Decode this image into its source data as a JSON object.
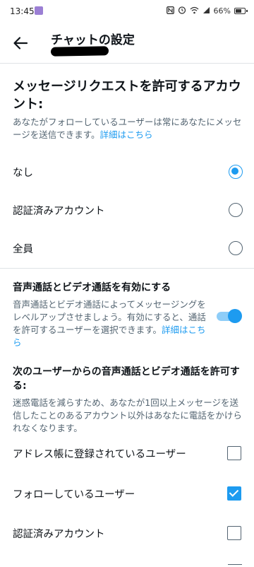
{
  "status_bar": {
    "time": "13:45",
    "battery_pct": "66%",
    "icons": [
      "nfc-icon",
      "alarm-icon",
      "wifi-icon",
      "signal-icon",
      "battery-icon"
    ]
  },
  "header": {
    "title": "チャットの設定",
    "back_icon": "arrow-left-icon"
  },
  "message_requests": {
    "heading": "メッセージリクエストを許可するアカウント:",
    "description": "あなたがフォローしているユーザーは常にあなたにメッセージを送信できます。",
    "link": "詳細はこちら",
    "options": [
      {
        "label": "なし",
        "selected": true
      },
      {
        "label": "認証済みアカウント",
        "selected": false
      },
      {
        "label": "全員",
        "selected": false
      }
    ]
  },
  "calls": {
    "toggle_title": "音声通話とビデオ通話を有効にする",
    "toggle_description": "音声通話とビデオ通話によってメッセージングをレベルアップさせましょう。有効にすると、通話を許可するユーザーを選択できます。",
    "toggle_link": "詳細はこちら",
    "toggle_on": true,
    "allow_heading": "次のユーザーからの音声通話とビデオ通話を許可する:",
    "allow_description": "迷惑電話を減らすため、あなたが1回以上メッセージを送信したことのあるアカウント以外はあなたに電話をかけられなくなります。",
    "checkboxes": [
      {
        "label": "アドレス帳に登録されているユーザー",
        "checked": false
      },
      {
        "label": "フォローしているユーザー",
        "checked": true
      },
      {
        "label": "認証済みアカウント",
        "checked": false
      }
    ]
  },
  "colors": {
    "accent": "#1d9bf0",
    "text_primary": "#0f1419",
    "text_secondary": "#536471",
    "divider": "#dfe3e6"
  }
}
